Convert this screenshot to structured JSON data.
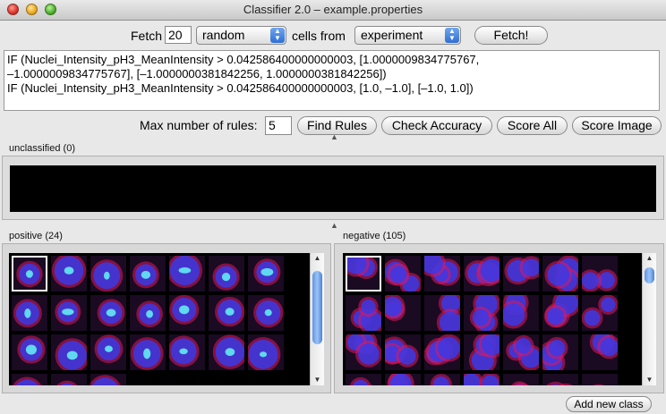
{
  "window": {
    "title": "Classifier 2.0 – example.properties"
  },
  "fetch": {
    "fetch_label": "Fetch",
    "count": "20",
    "method": "random",
    "cells_from_label": "cells from",
    "source": "experiment",
    "button": "Fetch!"
  },
  "rules": {
    "text": "IF (Nuclei_Intensity_pH3_MeanIntensity > 0.042586400000000003, [1.0000009834775767,\n–1.0000009834775767], [–1.0000000381842256, 1.0000000381842256])\nIF (Nuclei_Intensity_pH3_MeanIntensity > 0.042586400000000003, [1.0, –1.0], [–1.0, 1.0])"
  },
  "controls": {
    "max_rules_label": "Max number of rules:",
    "max_rules": "5",
    "find_rules": "Find Rules",
    "check_accuracy": "Check Accuracy",
    "score_all": "Score All",
    "score_image": "Score Image"
  },
  "bins": {
    "unclassified": {
      "label": "unclassified (0)"
    },
    "positive": {
      "label": "positive (24)"
    },
    "negative": {
      "label": "negative (105)"
    }
  },
  "footer": {
    "add_class": "Add new class"
  },
  "colors": {
    "membrane": "#e0185a",
    "nucleus": "#3a3ae8",
    "ph3": "#5fd8f0"
  }
}
